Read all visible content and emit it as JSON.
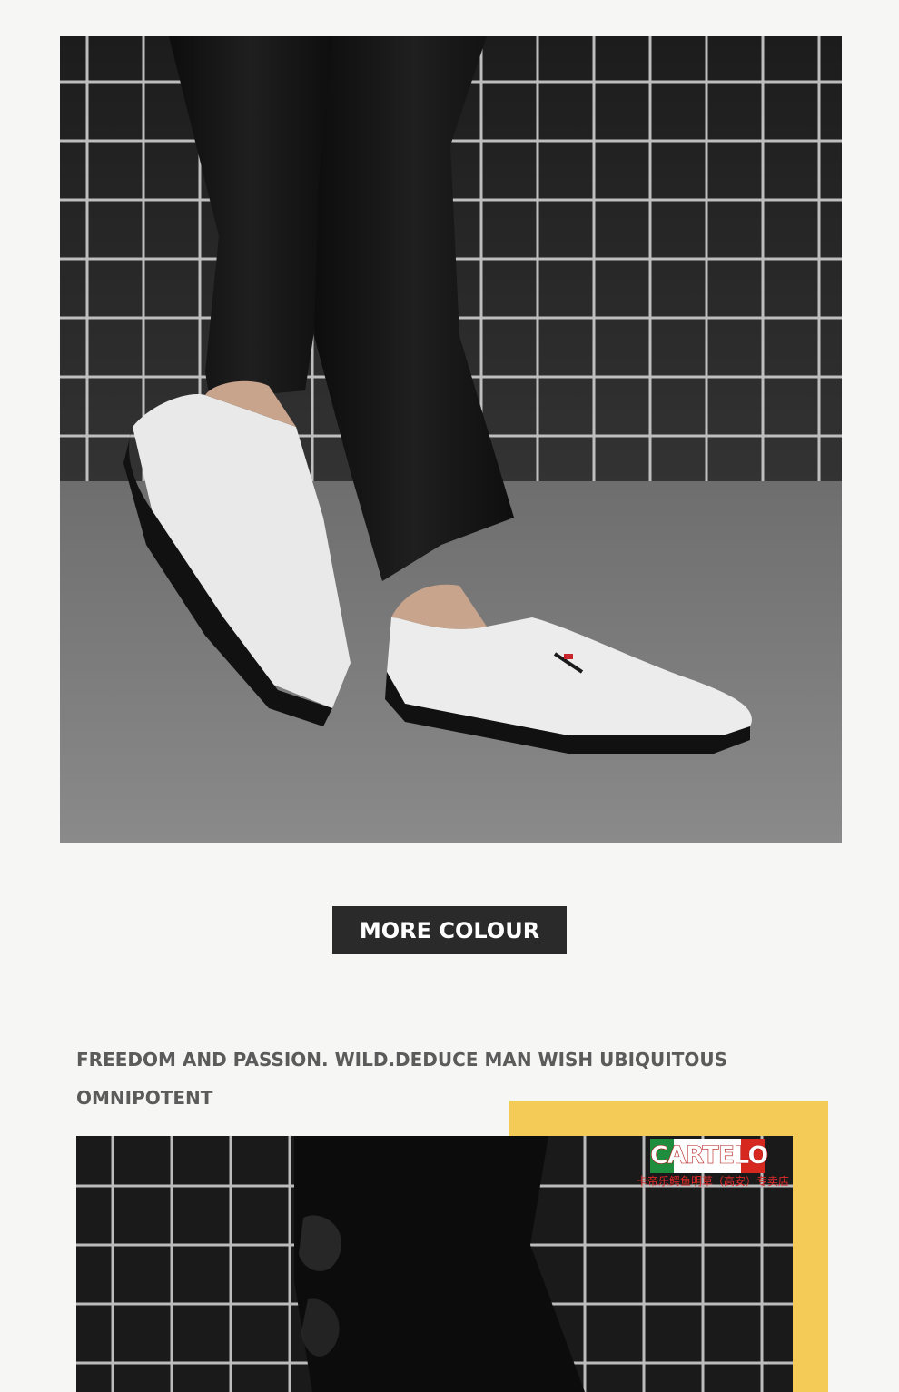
{
  "hero_image": {
    "description_icon": "white-loafer-photo"
  },
  "more_colour_label": "MORE COLOUR",
  "tagline": {
    "line1": "FREEDOM AND PASSION. WILD.DEDUCE MAN WISH UBIQUITOUS",
    "line2": "OMNIPOTENT"
  },
  "brand": {
    "logo_text": "CARTELO",
    "store_name": "卡帝乐鳄鱼明草（高安）专卖店"
  },
  "colors": {
    "background": "#f6f6f5",
    "button": "#2a2a2a",
    "accent_yellow": "#f3cb56",
    "brand_green": "#1f8d3e",
    "brand_red": "#d6281f"
  }
}
